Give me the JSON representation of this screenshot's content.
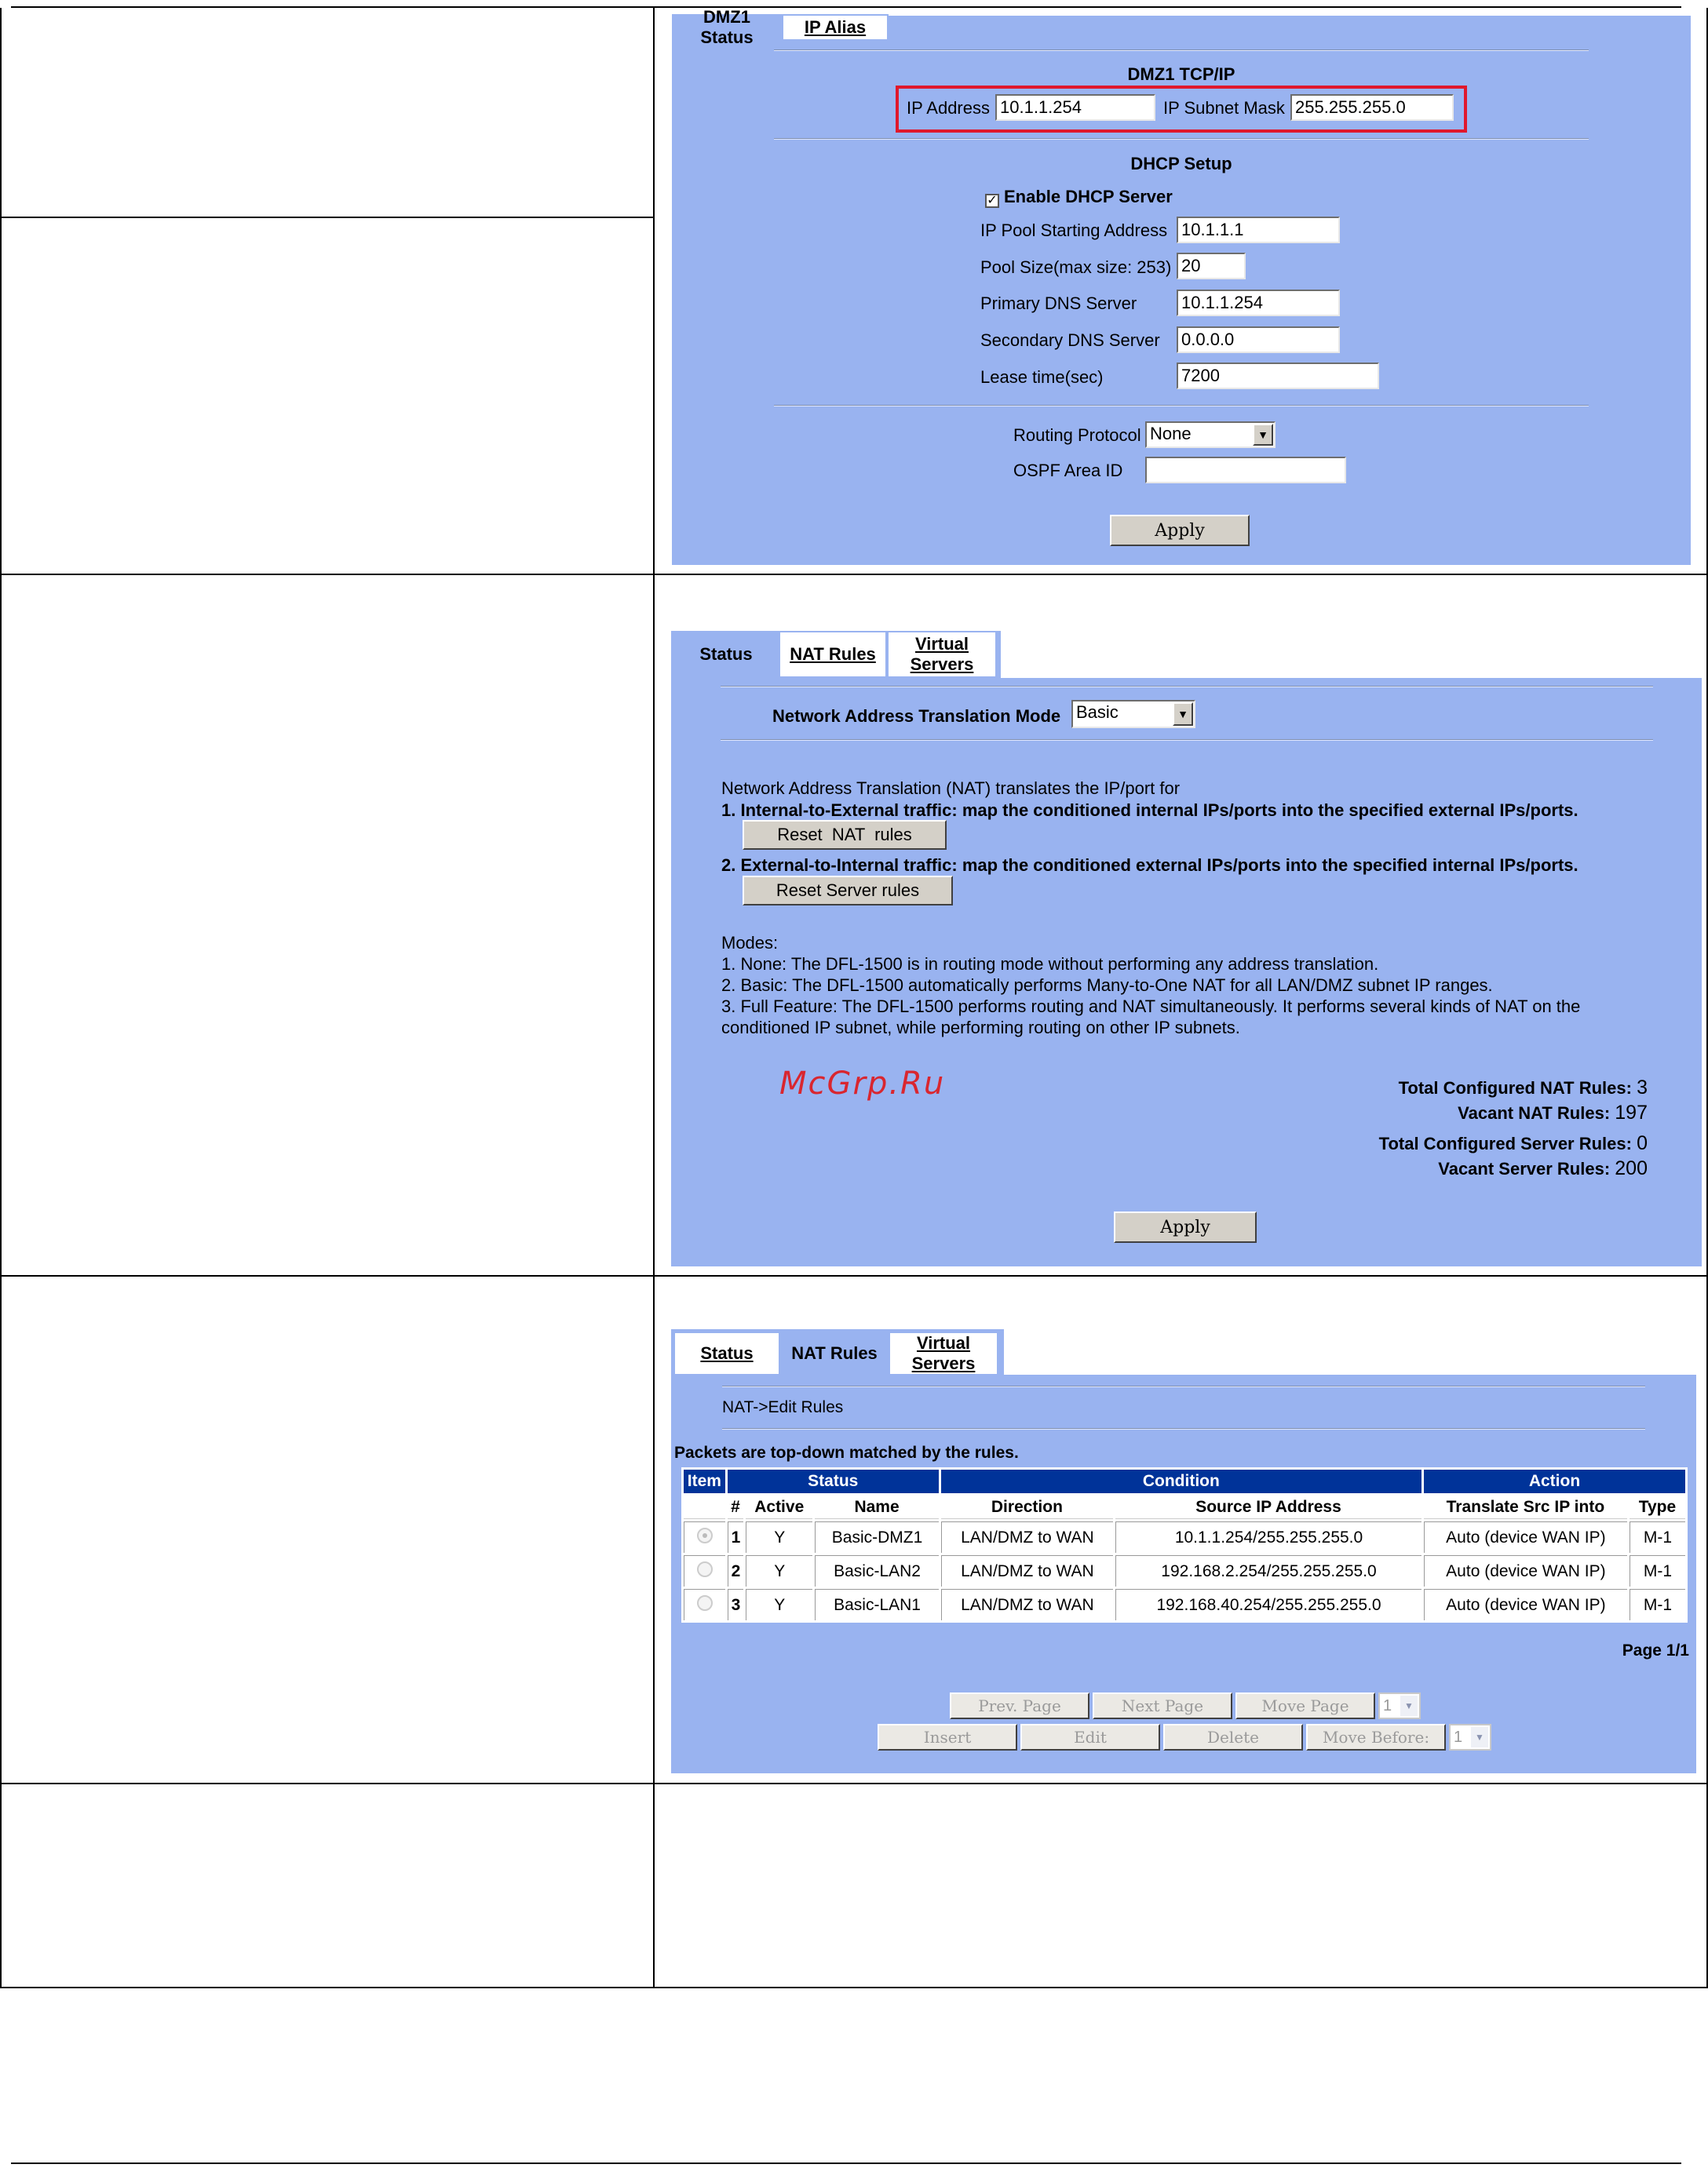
{
  "dmz": {
    "tabs": [
      "DMZ1 Status",
      "IP Alias"
    ],
    "tcpip_title": "DMZ1 TCP/IP",
    "ip_address_label": "IP Address",
    "ip_address_value": "10.1.1.254",
    "subnet_label": "IP Subnet Mask",
    "subnet_value": "255.255.255.0",
    "dhcp_title": "DHCP Setup",
    "enable_dhcp_label": "Enable DHCP Server",
    "enable_dhcp_checked": true,
    "fields": [
      {
        "label": "IP Pool Starting Address",
        "value": "10.1.1.1"
      },
      {
        "label": "Pool Size(max size: 253)",
        "value": "20"
      },
      {
        "label": "Primary DNS Server",
        "value": "10.1.1.254"
      },
      {
        "label": "Secondary DNS Server",
        "value": "0.0.0.0"
      },
      {
        "label": "Lease time(sec)",
        "value": "7200"
      }
    ],
    "routing_label": "Routing Protocol",
    "routing_value": "None",
    "ospf_label": "OSPF Area ID",
    "ospf_value": "",
    "apply_label": "Apply"
  },
  "nat": {
    "tabs": [
      "Status",
      "NAT Rules",
      "Virtual Servers"
    ],
    "mode_label": "Network Address Translation Mode",
    "mode_value": "Basic",
    "intro": "Network Address Translation (NAT) translates the IP/port for",
    "item1": "1. Internal-to-External traffic: map the conditioned internal IPs/ports into the specified external IPs/ports.",
    "reset_nat": "Reset  NAT  rules",
    "item2": "2. External-to-Internal traffic: map the conditioned external IPs/ports into the specified internal IPs/ports.",
    "reset_server": "Reset Server rules",
    "modes_title": "Modes:",
    "mode1": "1. None: The DFL-1500 is in routing mode without performing any address translation.",
    "mode2": "2. Basic: The DFL-1500 automatically performs Many-to-One NAT for all LAN/DMZ subnet IP ranges.",
    "mode3a": "3. Full Feature: The DFL-1500 performs routing and NAT simultaneously. It performs several kinds of NAT on the",
    "mode3b": "conditioned IP subnet, while performing routing on other IP subnets.",
    "watermark": "McGrp.Ru",
    "total_nat_label": "Total Configured NAT Rules:",
    "total_nat_value": "3",
    "vacant_nat_label": "Vacant NAT Rules:",
    "vacant_nat_value": "197",
    "total_server_label": "Total Configured Server Rules:",
    "total_server_value": "0",
    "vacant_server_label": "Vacant Server Rules:",
    "vacant_server_value": "200",
    "apply_label": "Apply"
  },
  "rules": {
    "tabs": [
      "Status",
      "NAT Rules",
      "Virtual Servers"
    ],
    "breadcrumb": "NAT->Edit Rules",
    "note": "Packets are top-down matched by the rules.",
    "groups": [
      "Item",
      "Status",
      "Condition",
      "Action"
    ],
    "columns": [
      "#",
      "Active",
      "Name",
      "Direction",
      "Source IP Address",
      "Translate Src IP into",
      "Type"
    ],
    "rows": [
      {
        "num": "1",
        "active": "Y",
        "name": "Basic-DMZ1",
        "direction": "LAN/DMZ to WAN",
        "source": "10.1.1.254/255.255.255.0",
        "translate": "Auto (device WAN IP)",
        "type": "M-1"
      },
      {
        "num": "2",
        "active": "Y",
        "name": "Basic-LAN2",
        "direction": "LAN/DMZ to WAN",
        "source": "192.168.2.254/255.255.255.0",
        "translate": "Auto (device WAN IP)",
        "type": "M-1"
      },
      {
        "num": "3",
        "active": "Y",
        "name": "Basic-LAN1",
        "direction": "LAN/DMZ to WAN",
        "source": "192.168.40.254/255.255.255.0",
        "translate": "Auto (device WAN IP)",
        "type": "M-1"
      }
    ],
    "page": "Page 1/1",
    "prev_page": "Prev. Page",
    "next_page": "Next Page",
    "move_page": "Move Page",
    "page_select": "1",
    "insert": "Insert",
    "edit": "Edit",
    "delete": "Delete",
    "move_before": "Move Before:",
    "before_select": "1"
  }
}
